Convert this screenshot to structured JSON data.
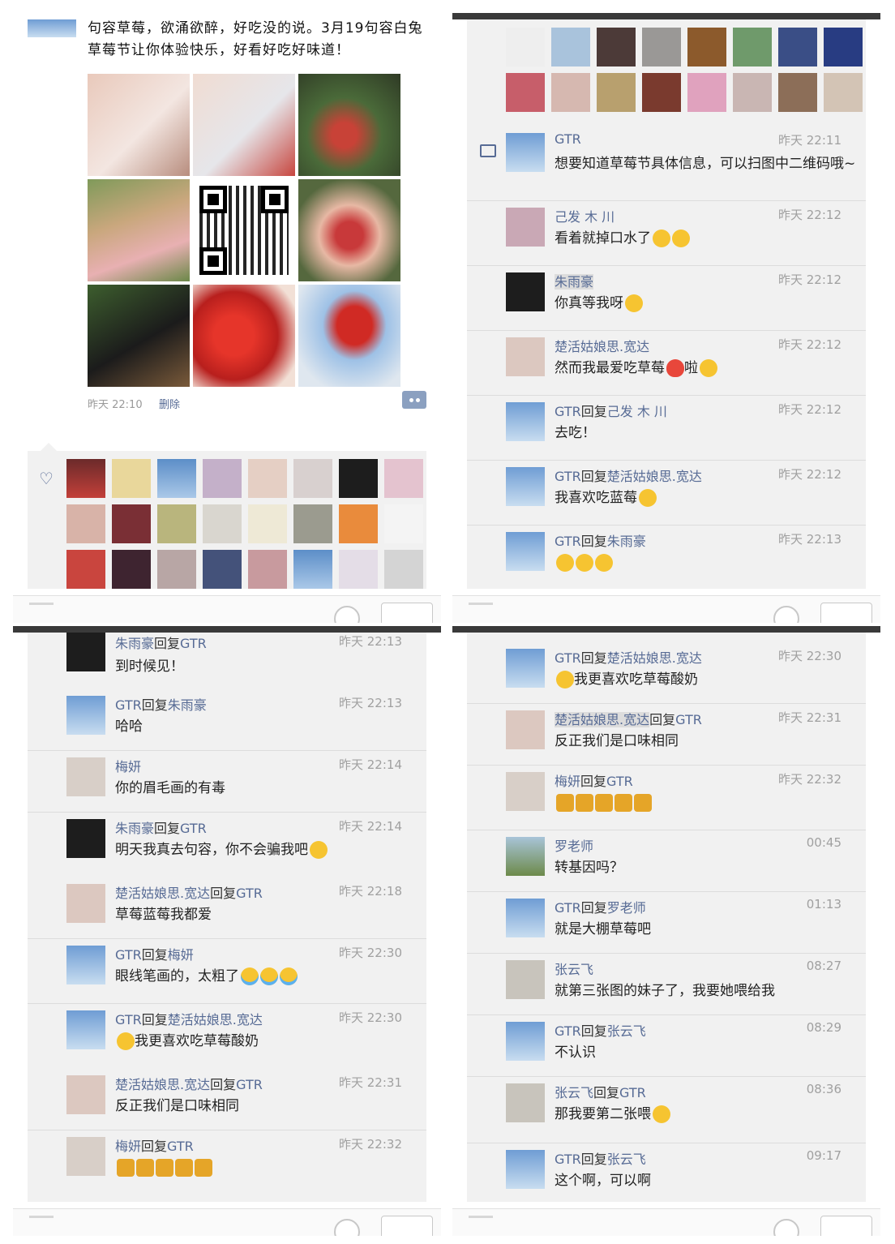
{
  "colors": {
    "link": "#576b95",
    "time": "#a0a0a0",
    "bar": "#3a3a3a",
    "feed_bg": "#f1f1f1"
  },
  "post": {
    "text": "句容草莓，欲涌欲醉，好吃没的说。3月19句容白兔草莓节让你体验快乐，好看好吃好味道！",
    "time": "昨天 22:10",
    "delete_label": "删除"
  },
  "panel2": {
    "comments": [
      {
        "name": "GTR",
        "time": "昨天 22:11",
        "text": "想要知道草莓节具体信息，可以扫图中二维码哦~"
      },
      {
        "name": "己发 木 川",
        "time": "昨天 22:12",
        "text": "看着就掉口水了"
      },
      {
        "name": "朱雨豪",
        "time": "昨天 22:12",
        "text": "你真等我呀"
      },
      {
        "name": "楚活姑娘思.宽达",
        "time": "昨天 22:12",
        "text": "然而我最爱吃草莓",
        "tail": "啦"
      },
      {
        "name_a": "GTR",
        "reply": "回复",
        "name_b": "己发 木 川",
        "time": "昨天 22:12",
        "text": "去吃！"
      },
      {
        "name_a": "GTR",
        "reply": "回复",
        "name_b": "楚活姑娘思.宽达",
        "time": "昨天 22:12",
        "text": "我喜欢吃蓝莓"
      },
      {
        "name_a": "GTR",
        "reply": "回复",
        "name_b": "朱雨豪",
        "time": "昨天 22:13",
        "text": ""
      }
    ]
  },
  "panel3": {
    "comments": [
      {
        "name_a": "朱雨豪",
        "reply": "回复",
        "name_b": "GTR",
        "time": "昨天 22:13",
        "text": "到时候见！"
      },
      {
        "name_a": "GTR",
        "reply": "回复",
        "name_b": "朱雨豪",
        "time": "昨天 22:13",
        "text": "哈哈"
      },
      {
        "name": "梅妍",
        "time": "昨天 22:14",
        "text": "你的眉毛画的有毒"
      },
      {
        "name_a": "朱雨豪",
        "reply": "回复",
        "name_b": "GTR",
        "time": "昨天 22:14",
        "text": "明天我真去句容，你不会骗我吧"
      },
      {
        "name_a": "楚活姑娘思.宽达",
        "reply": "回复",
        "name_b": "GTR",
        "time": "昨天 22:18",
        "text": "草莓蓝莓我都爱"
      },
      {
        "name_a": "GTR",
        "reply": "回复",
        "name_b": "梅妍",
        "time": "昨天 22:30",
        "text": "眼线笔画的，太粗了"
      },
      {
        "name_a": "GTR",
        "reply": "回复",
        "name_b": "楚活姑娘思.宽达",
        "time": "昨天 22:30",
        "text": "我更喜欢吃草莓酸奶"
      },
      {
        "name_a": "楚活姑娘思.宽达",
        "reply": "回复",
        "name_b": "GTR",
        "time": "昨天 22:31",
        "text": "反正我们是口味相同"
      },
      {
        "name_a": "梅妍",
        "reply": "回复",
        "name_b": "GTR",
        "time": "昨天 22:32",
        "text": ""
      }
    ]
  },
  "panel4": {
    "comments": [
      {
        "name_a": "GTR",
        "reply": "回复",
        "name_b": "楚活姑娘思.宽达",
        "time": "昨天 22:30",
        "text": "我更喜欢吃草莓酸奶"
      },
      {
        "name_a": "楚活姑娘思.宽达",
        "reply": "回复",
        "name_b": "GTR",
        "time": "昨天 22:31",
        "text": "反正我们是口味相同"
      },
      {
        "name_a": "梅妍",
        "reply": "回复",
        "name_b": "GTR",
        "time": "昨天 22:32",
        "text": ""
      },
      {
        "name": "罗老师",
        "time": "00:45",
        "text": "转基因吗？"
      },
      {
        "name_a": "GTR",
        "reply": "回复",
        "name_b": "罗老师",
        "time": "01:13",
        "text": "就是大棚草莓吧"
      },
      {
        "name": "张云飞",
        "time": "08:27",
        "text": "就第三张图的妹子了，我要她喂给我"
      },
      {
        "name_a": "GTR",
        "reply": "回复",
        "name_b": "张云飞",
        "time": "08:29",
        "text": "不认识"
      },
      {
        "name_a": "张云飞",
        "reply": "回复",
        "name_b": "GTR",
        "time": "08:36",
        "text": "那我要第二张喂"
      },
      {
        "name_a": "GTR",
        "reply": "回复",
        "name_b": "张云飞",
        "time": "09:17",
        "text": "这个啊，可以啊"
      }
    ]
  }
}
